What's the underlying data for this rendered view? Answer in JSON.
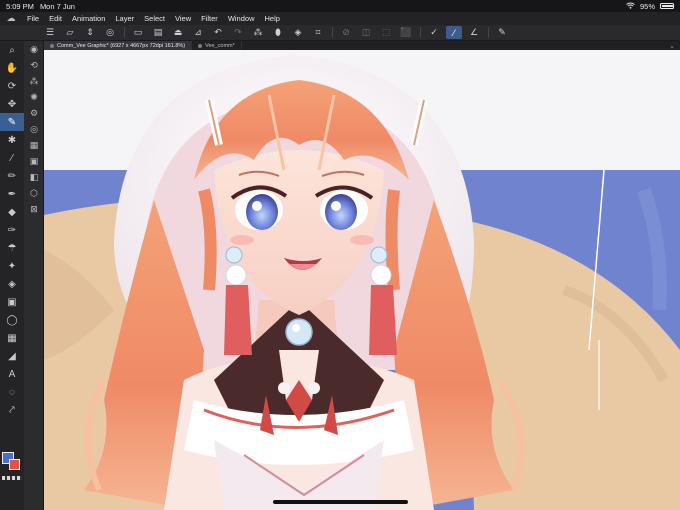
{
  "status": {
    "time": "5:09 PM",
    "date": "Mon 7 Jun",
    "battery_text": "95%",
    "battery_level": 0.95
  },
  "menu": {
    "items": [
      "File",
      "Edit",
      "Animation",
      "Layer",
      "Select",
      "View",
      "Filter",
      "Window",
      "Help"
    ]
  },
  "tabs": [
    {
      "label": "Comm_Vee Graphic* (6927 x 4667px 72dpi 161.8%)",
      "active": true
    },
    {
      "label": "Vee_comm*",
      "active": false
    }
  ],
  "icons": {
    "app": "clip-studio-icon",
    "wifi": "wifi-icon",
    "battery": "battery-icon",
    "toolbar": [
      "hamburger-menu-icon",
      "new-file-icon",
      "stepper-icon",
      "quick-access-icon",
      "open-folder-icon",
      "save-icon",
      "canvas-icon",
      "fill-icon",
      "undo-icon",
      "redo-icon",
      "select-icon",
      "clear-icon",
      "transform-icon",
      "crop-icon",
      "selection-off-icon",
      "invert-icon",
      "pen-stabilize-icon",
      "pen-pressure-icon",
      "pen-line-icon",
      "settings-icon"
    ]
  },
  "colors": {
    "main": "#4a6fc8",
    "sub": "#e0524a",
    "accent": "#3a5f94"
  }
}
